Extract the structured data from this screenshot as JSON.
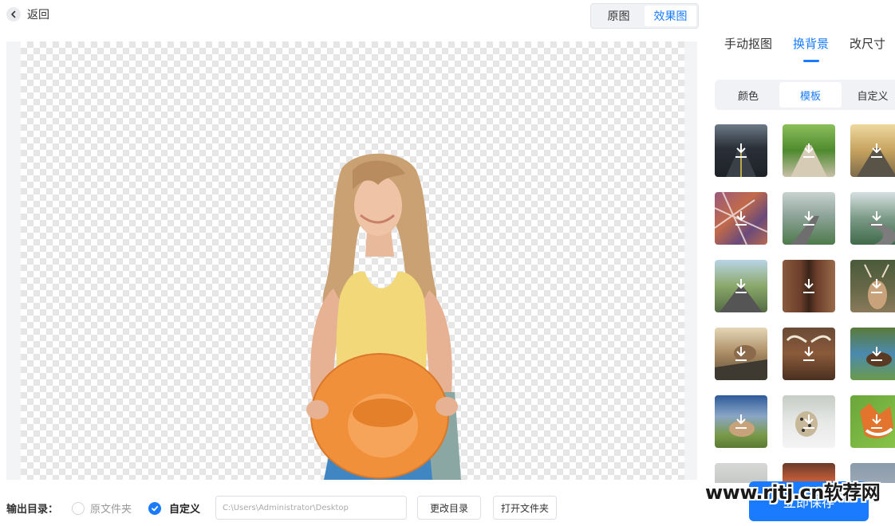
{
  "header": {
    "back_label": "返回",
    "view_toggle": [
      {
        "label": "原图",
        "active": false
      },
      {
        "label": "效果图",
        "active": true
      }
    ]
  },
  "right_panel": {
    "tabs": [
      {
        "label": "手动抠图",
        "active": false
      },
      {
        "label": "换背景",
        "active": true
      },
      {
        "label": "改尺寸",
        "active": false
      }
    ],
    "sub_tabs": [
      {
        "label": "颜色",
        "active": false
      },
      {
        "label": "模板",
        "active": true
      },
      {
        "label": "自定义",
        "active": false
      }
    ],
    "templates": [
      "dark-road",
      "green-field-road",
      "sunset-road",
      "autumn-branches",
      "foggy-road",
      "coastal-road",
      "forest-road",
      "tree-bark",
      "deer",
      "sparrow",
      "highland-cow",
      "horse-lake",
      "horse-grass",
      "snow-leopard",
      "fox",
      "snow-scene",
      "sunset-sky",
      "mountain"
    ]
  },
  "bottom_bar": {
    "output_label": "输出目录：",
    "radio_original": "原文件夹",
    "radio_custom": "自定义",
    "path_value": "C:\\Users\\Administrator\\Desktop",
    "change_dir_label": "更改目录",
    "open_folder_label": "打开文件夹",
    "save_label": "立即保存"
  },
  "watermark": "www.rjtj.cn软荐网",
  "colors": {
    "accent": "#1a7bff",
    "hat": "#f0903a",
    "top": "#f2d878",
    "jeans": "#3f86c2",
    "hair": "#c9a173"
  }
}
